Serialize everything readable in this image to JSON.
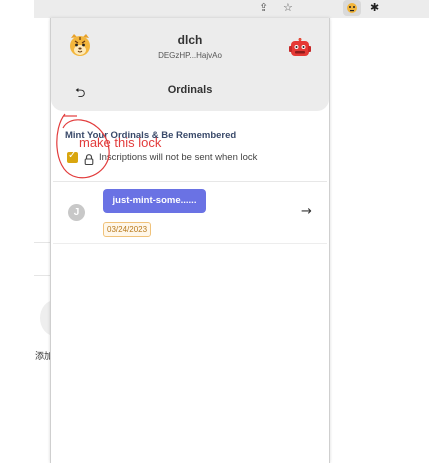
{
  "browser": {
    "icons": [
      "share-icon",
      "star-icon",
      "extension-tiger-icon",
      "puzzle-icon"
    ]
  },
  "background": {
    "partial_text": "添加"
  },
  "header": {
    "account_name": "dlch",
    "address": "DEGzHP...HajvAo",
    "page_title": "Ordinals"
  },
  "banner": {
    "title": "Mint Your Ordinals & Be Remembered",
    "lock_label": "Inscriptions will not be sent when lock",
    "lock_checked": true
  },
  "annotation": {
    "text": "make this lock",
    "color": "#e23c3c"
  },
  "inscriptions": [
    {
      "avatar_letter": "J",
      "name": "just-mint-some......",
      "date": "03/24/2023"
    }
  ],
  "colors": {
    "accent": "#6a72e4",
    "checkbox": "#d9a60f",
    "date_badge": "#b8791b",
    "header_bg": "#ececec"
  }
}
